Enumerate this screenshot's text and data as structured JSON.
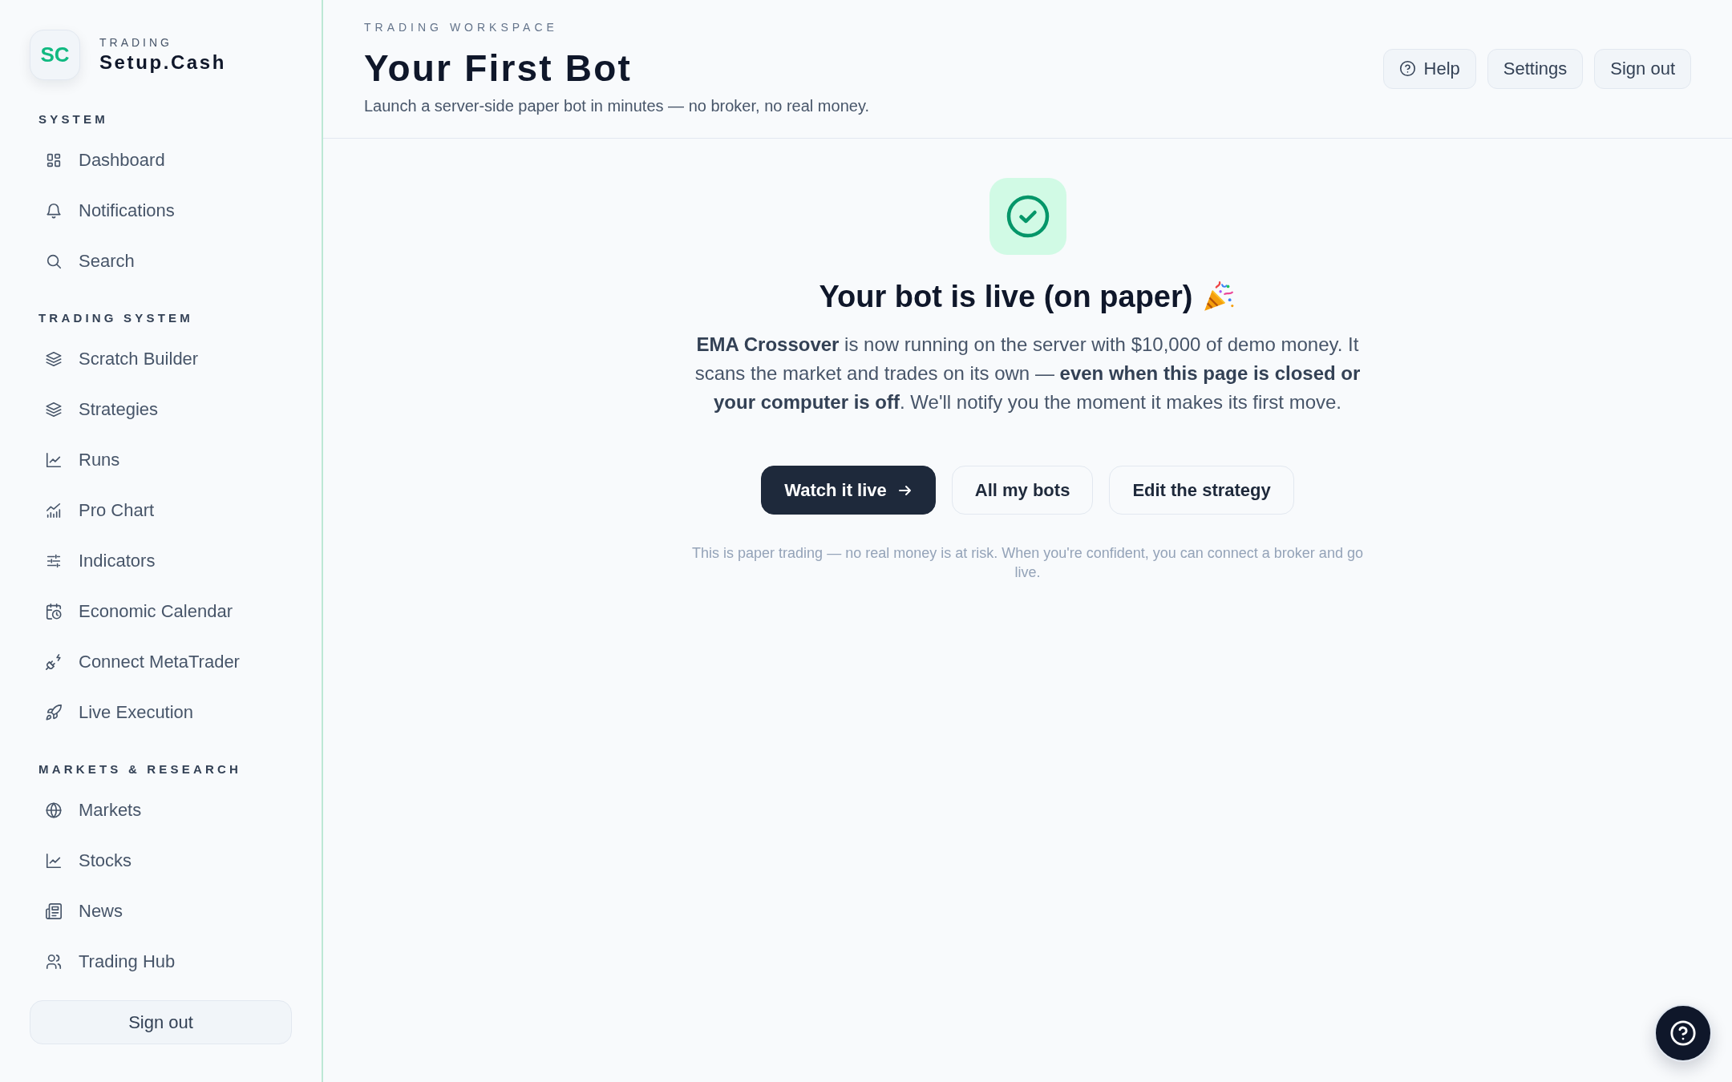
{
  "sidebar": {
    "logo": {
      "initials": "SC",
      "caption": "TRADING",
      "name": "Setup.Cash"
    },
    "sections": [
      {
        "title": "SYSTEM",
        "items": [
          {
            "label": "Dashboard"
          },
          {
            "label": "Notifications"
          },
          {
            "label": "Search"
          }
        ]
      },
      {
        "title": "TRADING SYSTEM",
        "items": [
          {
            "label": "Scratch Builder"
          },
          {
            "label": "Strategies"
          },
          {
            "label": "Runs"
          },
          {
            "label": "Pro Chart"
          },
          {
            "label": "Indicators"
          },
          {
            "label": "Economic Calendar"
          },
          {
            "label": "Connect MetaTrader"
          },
          {
            "label": "Live Execution"
          }
        ]
      },
      {
        "title": "MARKETS & RESEARCH",
        "items": [
          {
            "label": "Markets"
          },
          {
            "label": "Stocks"
          },
          {
            "label": "News"
          },
          {
            "label": "Trading Hub"
          }
        ]
      }
    ],
    "sign_out": "Sign out"
  },
  "header": {
    "eyebrow": "TRADING WORKSPACE",
    "title": "Your First Bot",
    "subtitle": "Launch a server-side paper bot in minutes — no broker, no real money.",
    "buttons": [
      {
        "label": "Help",
        "kind": "icon"
      },
      {
        "label": "Settings",
        "kind": "plain"
      },
      {
        "label": "Sign out",
        "kind": "plain"
      }
    ]
  },
  "confirmation": {
    "heading": "Your bot is live (on paper)",
    "message": "**EMA Crossover** is now running on the server with $10,000 of demo money. It scans the market and trades on its own — **even when this page is closed or your computer is off**. We'll notify you the moment it makes its first move.",
    "actions": [
      {
        "label": "Watch it live",
        "kind": "primary"
      },
      {
        "label": "All my bots",
        "kind": "secondary"
      },
      {
        "label": "Edit the strategy",
        "kind": "secondary"
      }
    ],
    "note": "This is paper trading — no real money is at risk. When you're confident, you can connect a broker and go live."
  }
}
